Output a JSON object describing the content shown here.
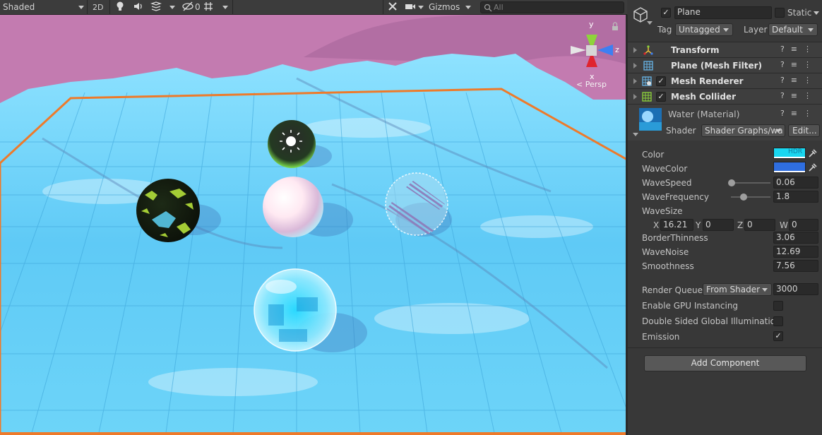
{
  "toolbar": {
    "shading_mode": "Shaded",
    "mode_2d": "2D",
    "hidden_count": "0",
    "gizmos": "Gizmos",
    "search_placeholder": "All"
  },
  "viewport": {
    "projection_label": "< Persp",
    "axis_labels": {
      "x": "x",
      "y": "y",
      "z": "z"
    }
  },
  "inspector": {
    "object_name": "Plane",
    "static_label": "Static",
    "static_checked": false,
    "active_checked": true,
    "tag_label": "Tag",
    "tag_value": "Untagged",
    "layer_label": "Layer",
    "layer_value": "Default",
    "components": [
      {
        "name": "Transform",
        "has_checkbox": false
      },
      {
        "name": "Plane (Mesh Filter)",
        "has_checkbox": false
      },
      {
        "name": "Mesh Renderer",
        "has_checkbox": true
      },
      {
        "name": "Mesh Collider",
        "has_checkbox": true
      }
    ],
    "material": {
      "name": "Water (Material)",
      "shader_label": "Shader",
      "shader_value": "Shader Graphs/wa",
      "edit_label": "Edit..."
    },
    "properties": {
      "color_label": "Color",
      "color_hdr": "HDR",
      "wavecolor_label": "WaveColor",
      "wavespeed_label": "WaveSpeed",
      "wavespeed_value": "0.06",
      "wavespeed_fraction": 0.06,
      "wavefrequency_label": "WaveFrequency",
      "wavefrequency_value": "1.8",
      "wavefrequency_fraction": 0.3,
      "wavesize_label": "WaveSize",
      "wavesize": {
        "x": "16.21",
        "y": "0",
        "z": "0",
        "w": "0"
      },
      "borderthinness_label": "BorderThinness",
      "borderthinness_value": "3.06",
      "wavenoise_label": "WaveNoise",
      "wavenoise_value": "12.69",
      "smoothness_label": "Smoothness",
      "smoothness_value": "7.56"
    },
    "render_queue_label": "Render Queue",
    "render_queue_mode": "From Shader",
    "render_queue_value": "3000",
    "gpu_instancing_label": "Enable GPU Instancing",
    "double_sided_gi_label": "Double Sided Global Illumination",
    "emission_label": "Emission",
    "add_component_label": "Add Component"
  },
  "colors": {
    "selection_outline": "#ee7a2a",
    "water": "#5bc7f5",
    "sky": "#c37bb0",
    "wave_color": "#2f6ee0",
    "base_color": "#19d7f0"
  }
}
